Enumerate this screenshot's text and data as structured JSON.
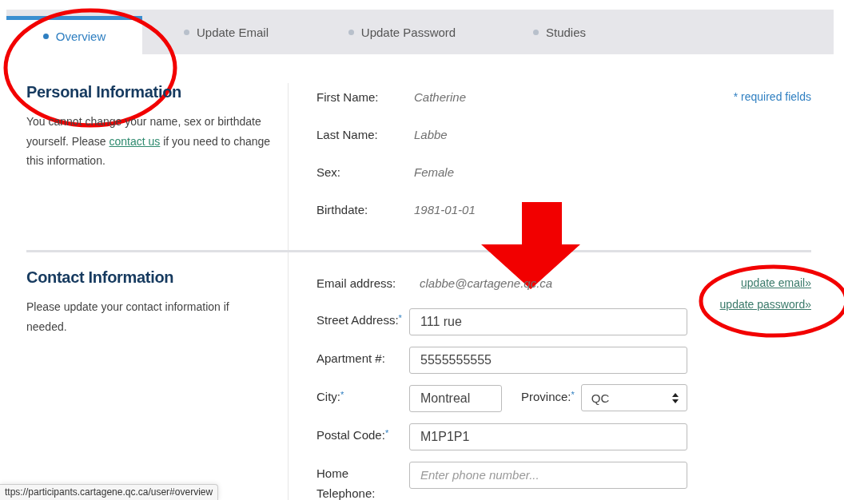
{
  "tabs": [
    {
      "label": "Overview",
      "selected": true
    },
    {
      "label": "Update Email",
      "selected": false
    },
    {
      "label": "Update Password",
      "selected": false
    },
    {
      "label": "Studies",
      "selected": false
    }
  ],
  "personal": {
    "heading": "Personal Information",
    "text_before": "You cannot change your name, sex or birthdate yourself. Please ",
    "link": "contact us",
    "text_after": " if you need to change this information.",
    "required_note": "* required fields",
    "fields": [
      {
        "label": "First Name:",
        "value": "Catherine"
      },
      {
        "label": "Last Name:",
        "value": "Labbe"
      },
      {
        "label": "Sex:",
        "value": "Female"
      },
      {
        "label": "Birthdate:",
        "value": "1981-01-01"
      }
    ]
  },
  "contact": {
    "heading": "Contact Information",
    "description": "Please update your contact information if needed.",
    "email": {
      "label": "Email address:",
      "value": "clabbe@cartagene.qc.ca"
    },
    "links": [
      "update email»",
      "update password»"
    ],
    "rows": [
      {
        "fields": [
          {
            "kind": "text",
            "label": "Street Address:",
            "required_mark": "*",
            "value": "111 rue"
          }
        ]
      },
      {
        "fields": [
          {
            "kind": "text",
            "label": "Apartment #:",
            "value": "5555555555"
          }
        ]
      },
      {
        "fields": [
          {
            "kind": "text",
            "label": "City:",
            "required_mark": "*",
            "value": "Montreal"
          },
          {
            "kind": "select",
            "label": "Province:",
            "required_mark": "*",
            "value": "QC"
          }
        ]
      },
      {
        "fields": [
          {
            "kind": "text",
            "label": "Postal Code:",
            "required_mark": "*",
            "value": "M1P1P1"
          }
        ]
      },
      {
        "fields": [
          {
            "kind": "text",
            "label": "Home Telephone:",
            "placeholder": "Enter phone number..."
          }
        ]
      }
    ]
  },
  "status_url": "ttps://participants.cartagene.qc.ca/user#overview",
  "annotations": [
    {
      "kind": "ellipse"
    },
    {
      "kind": "arrow"
    },
    {
      "kind": "ellipse"
    }
  ]
}
